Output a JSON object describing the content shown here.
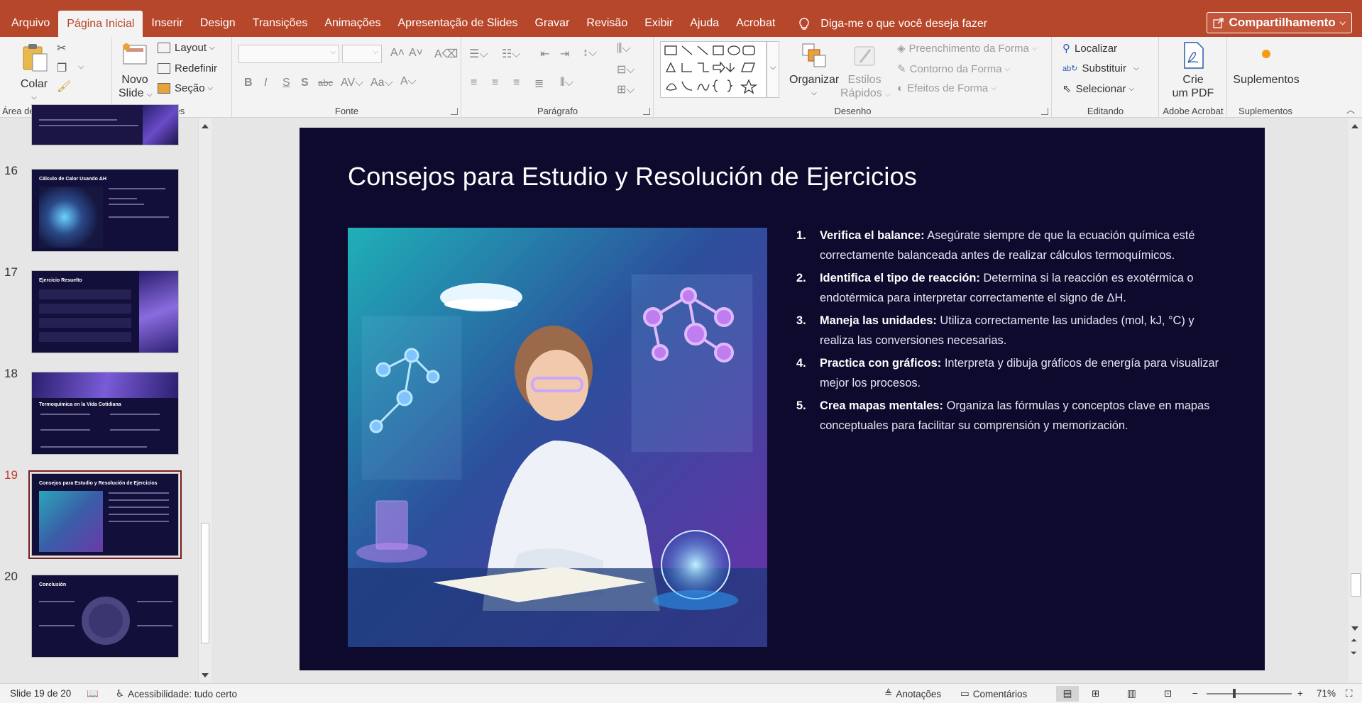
{
  "menu": {
    "tabs": [
      "Arquivo",
      "Página Inicial",
      "Inserir",
      "Design",
      "Transições",
      "Animações",
      "Apresentação de Slides",
      "Gravar",
      "Revisão",
      "Exibir",
      "Ajuda",
      "Acrobat"
    ],
    "active_tab": "Página Inicial",
    "tell_me": "Diga-me o que você deseja fazer",
    "share": "Compartilhamento"
  },
  "ribbon": {
    "clipboard": {
      "label": "Área de Transferência",
      "paste": "Colar"
    },
    "slides": {
      "label": "Slides",
      "new_slide_1": "Novo",
      "new_slide_2": "Slide",
      "layout": "Layout",
      "reset": "Redefinir",
      "section": "Seção"
    },
    "font": {
      "label": "Fonte"
    },
    "paragraph": {
      "label": "Parágrafo"
    },
    "drawing": {
      "label": "Desenho",
      "arrange": "Organizar",
      "quick_styles_1": "Estilos",
      "quick_styles_2": "Rápidos",
      "shape_fill": "Preenchimento da Forma",
      "shape_outline": "Contorno da Forma",
      "shape_effects": "Efeitos de Forma"
    },
    "editing": {
      "label": "Editando",
      "find": "Localizar",
      "replace": "Substituir",
      "select": "Selecionar"
    },
    "acrobat": {
      "label": "Adobe Acrobat",
      "create_pdf_1": "Crie",
      "create_pdf_2": "um PDF"
    },
    "addins": {
      "label": "Suplementos",
      "addins_btn": "Suplementos"
    }
  },
  "thumbnails": [
    {
      "num": "16",
      "title": "Cálculo de Calor Usando ΔH"
    },
    {
      "num": "17",
      "title": "Ejercicio Resuelto"
    },
    {
      "num": "18",
      "title": "Termoquímica en la Vida Cotidiana"
    },
    {
      "num": "19",
      "title": "Consejos para Estudio y Resolución de Ejercicios"
    },
    {
      "num": "20",
      "title": "Conclusión"
    }
  ],
  "slide": {
    "title": "Consejos para Estudio y Resolución de Ejercicios",
    "items": [
      {
        "n": "1.",
        "bold": "Verifica el balance:",
        "text": " Asegúrate siempre de que la ecuación química esté correctamente balanceada antes de realizar cálculos termoquímicos."
      },
      {
        "n": "2.",
        "bold": "Identifica el tipo de reacción:",
        "text": " Determina si la reacción es exotérmica o endotérmica para interpretar correctamente el signo de ΔH."
      },
      {
        "n": "3.",
        "bold": "Maneja las unidades:",
        "text": " Utiliza correctamente las unidades (mol, kJ, °C) y realiza las conversiones necesarias."
      },
      {
        "n": "4.",
        "bold": "Practica con gráficos:",
        "text": " Interpreta y dibuja gráficos de energía para visualizar mejor los procesos."
      },
      {
        "n": "5.",
        "bold": "Crea mapas mentales:",
        "text": " Organiza las fórmulas y conceptos clave en mapas conceptuales para facilitar su comprensión y memorización."
      }
    ]
  },
  "status": {
    "slide_count": "Slide 19 de 20",
    "accessibility": "Acessibilidade: tudo certo",
    "notes": "Anotações",
    "comments": "Comentários",
    "zoom": "71%"
  }
}
